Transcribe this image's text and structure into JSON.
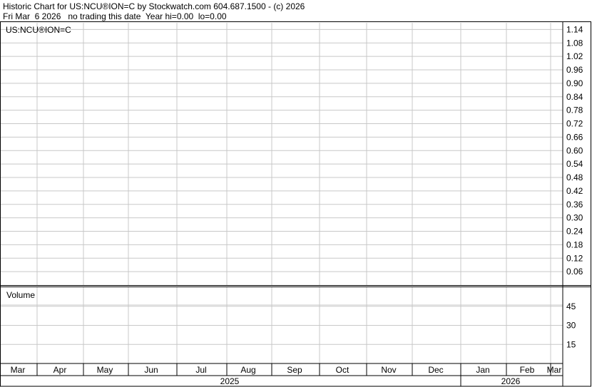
{
  "header": {
    "title": "Historic Chart for US:NCU®ION=C by Stockwatch.com 604.687.1500 - (c) 2026",
    "subtitle": "Fri Mar  6 2026   no trading this date  Year hi=0.00  lo=0.00"
  },
  "chart_data": [
    {
      "type": "line",
      "title": "US:NCU®ION=C",
      "series": [],
      "y_ticks": [
        "1.14",
        "1.08",
        "1.02",
        "0.96",
        "0.90",
        "0.84",
        "0.78",
        "0.72",
        "0.66",
        "0.60",
        "0.54",
        "0.48",
        "0.42",
        "0.36",
        "0.30",
        "0.24",
        "0.18",
        "0.12",
        "0.06"
      ],
      "ylim": [
        0,
        1.17
      ],
      "grid": true
    },
    {
      "type": "bar",
      "title": "Volume",
      "series": [],
      "y_ticks": [
        "45",
        "30",
        "15"
      ],
      "ylim": [
        0,
        60
      ],
      "grid": true
    }
  ],
  "x_axis": {
    "months": [
      "Mar",
      "Apr",
      "May",
      "Jun",
      "Jul",
      "Aug",
      "Sep",
      "Oct",
      "Nov",
      "Dec",
      "Jan",
      "Feb",
      "Mar"
    ],
    "years": [
      "2025",
      "2026"
    ]
  },
  "colors": {
    "grid": "#c8c8c8",
    "frame": "#000000",
    "background": "#ffffff"
  }
}
